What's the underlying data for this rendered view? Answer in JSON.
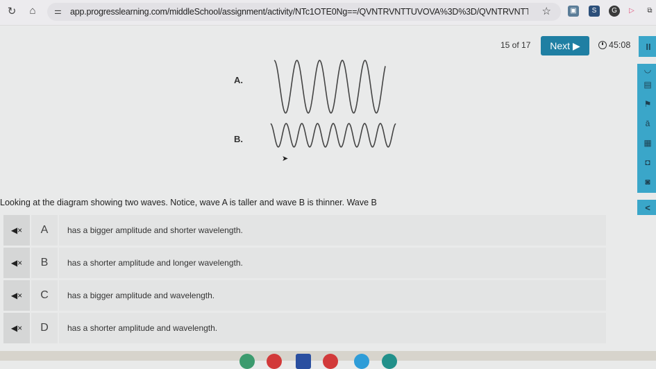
{
  "browser": {
    "url": "app.progresslearning.com/middleSchool/assignment/activity/NTc1OTE0Ng==/QVNTRVNTTUVOVA%3D%3D/QVNTRVNTTUVOVC01NzEyNT...",
    "reload_icon": "reload-icon",
    "home_icon": "home-icon",
    "site_info_icon": "site-info-icon",
    "bookmark_icon": "star-icon"
  },
  "header": {
    "counter": "15 of 17",
    "next_label": "Next ▶",
    "timer": "45:08",
    "pause_label": "II"
  },
  "diagram": {
    "wave_a_label": "A.",
    "wave_b_label": "B."
  },
  "question": {
    "text": "Looking at the diagram showing two waves. Notice, wave A is taller and wave B is thinner. Wave B"
  },
  "choices": [
    {
      "letter": "A",
      "text": "has a bigger amplitude and shorter wavelength."
    },
    {
      "letter": "B",
      "text": "has a shorter amplitude and longer wavelength."
    },
    {
      "letter": "C",
      "text": "has a bigger amplitude and wavelength."
    },
    {
      "letter": "D",
      "text": "has a shorter amplitude and wavelength."
    }
  ],
  "tools": {
    "collapse_label": "<"
  }
}
